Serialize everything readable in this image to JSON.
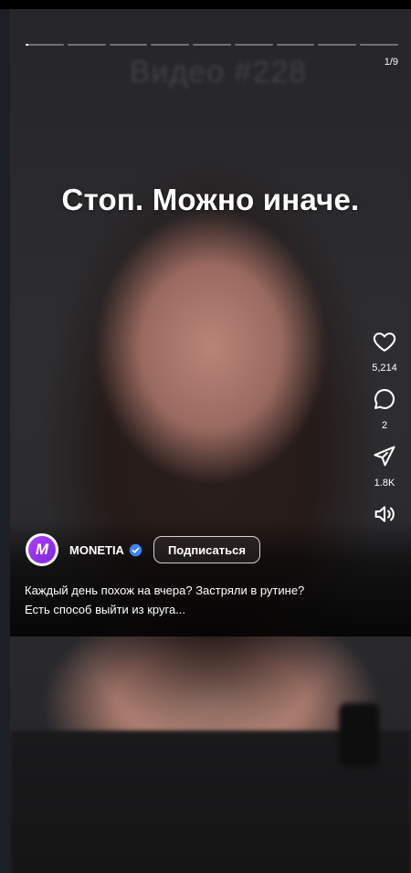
{
  "story": {
    "counter": "1/9",
    "segments": [
      {
        "progress": 0.08
      },
      {
        "progress": 0
      },
      {
        "progress": 0
      },
      {
        "progress": 0
      },
      {
        "progress": 0
      },
      {
        "progress": 0
      },
      {
        "progress": 0
      },
      {
        "progress": 0
      },
      {
        "progress": 0
      }
    ],
    "watermark": "Видео #228",
    "headline": "Стоп. Можно иначе."
  },
  "actions": {
    "likes": "5,214",
    "comments": "2",
    "shares": "1.8K"
  },
  "author": {
    "avatar_letter": "M",
    "name": "MONETIA",
    "subscribe_label": "Подписаться"
  },
  "caption": {
    "line1": "Каждый день похож на вчера? Застряли в рутине?",
    "line2": "Есть способ выйти из круга..."
  },
  "colors": {
    "accent": "#9b37f2",
    "verified": "#3b82f6",
    "background": "#1c1f26"
  },
  "icons": [
    "heart-icon",
    "comment-icon",
    "share-icon",
    "sound-icon",
    "verified-icon"
  ]
}
